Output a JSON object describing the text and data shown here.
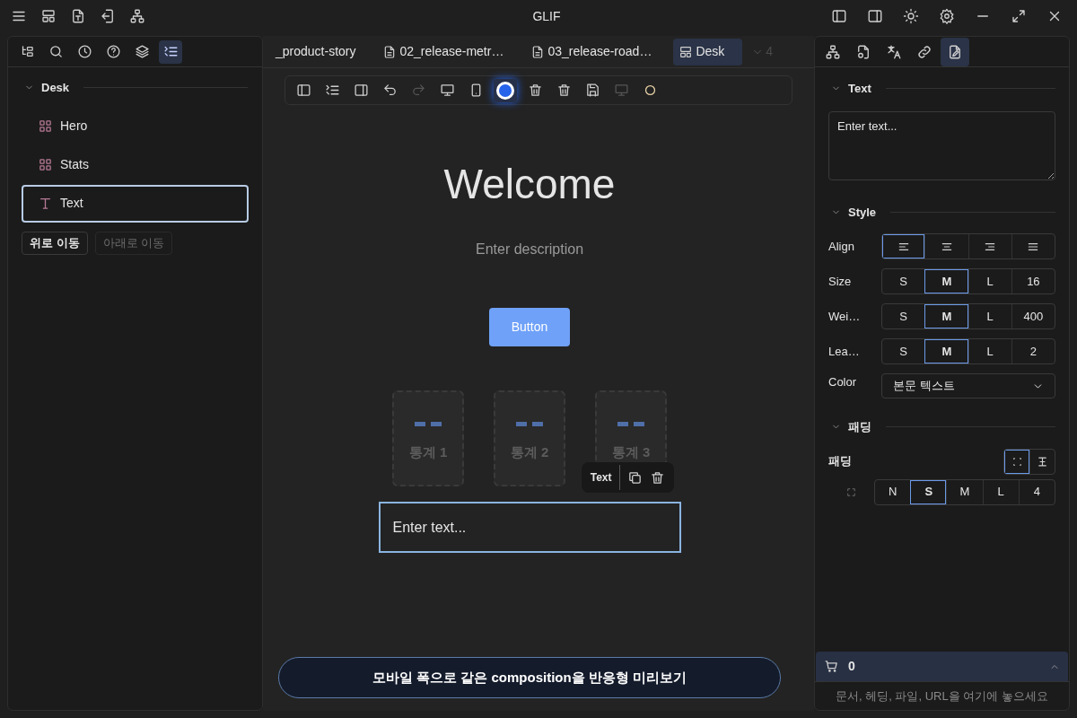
{
  "app": {
    "title": "GLIF"
  },
  "left_panel": {
    "tabs": [
      {
        "kind": "tree",
        "selected": false
      },
      {
        "kind": "search",
        "selected": false
      },
      {
        "kind": "clock",
        "selected": false
      },
      {
        "kind": "help",
        "selected": false
      },
      {
        "kind": "layers",
        "selected": false
      },
      {
        "kind": "outline",
        "selected": true
      }
    ],
    "section": {
      "title": "Desk",
      "expanded": true
    },
    "items": [
      {
        "kind": "block",
        "label": "Hero",
        "selected": false
      },
      {
        "kind": "block",
        "label": "Stats",
        "selected": false
      },
      {
        "kind": "text",
        "label": "Text",
        "selected": true
      }
    ],
    "buttons": [
      {
        "label": "위로 이동",
        "disabled": false
      },
      {
        "label": "아래로 이동",
        "disabled": true
      }
    ]
  },
  "doc_tabs": {
    "tabs": [
      {
        "kind": "plain",
        "label": "_product-story",
        "selected": false
      },
      {
        "kind": "doc",
        "label": "02_release-metr…",
        "selected": false
      },
      {
        "kind": "doc",
        "label": "03_release-road…",
        "selected": false
      },
      {
        "kind": "layout",
        "label": "Desk",
        "selected": true
      }
    ],
    "overflow": "4"
  },
  "toolbar": [
    {
      "kind": "sidebar-left",
      "disabled": false
    },
    {
      "kind": "outline",
      "disabled": false
    },
    {
      "kind": "sidebar-right",
      "disabled": false
    },
    {
      "kind": "undo",
      "disabled": false
    },
    {
      "kind": "redo",
      "disabled": true
    },
    {
      "kind": "monitor",
      "disabled": false
    },
    {
      "kind": "tablet",
      "disabled": false
    },
    {
      "kind": "color",
      "disabled": false
    },
    {
      "kind": "trash",
      "disabled": false
    },
    {
      "kind": "trash",
      "disabled": false
    },
    {
      "kind": "save",
      "disabled": false
    },
    {
      "kind": "monitor",
      "disabled": true
    },
    {
      "kind": "circle",
      "disabled": false
    }
  ],
  "canvas": {
    "heading": "Welcome",
    "description": "Enter description",
    "button": "Button",
    "stats": [
      {
        "label": "통계 1"
      },
      {
        "label": "통계 2"
      },
      {
        "label": "통계 3"
      }
    ],
    "selection_toolbar": {
      "label": "Text"
    },
    "text_block": "Enter text...",
    "preview_button": "모바일 폭으로 같은 composition을 반응형 미리보기"
  },
  "right_panel": {
    "tabs": [
      {
        "kind": "sitemap",
        "selected": false
      },
      {
        "kind": "file-search",
        "selected": false
      },
      {
        "kind": "translate",
        "selected": false
      },
      {
        "kind": "link",
        "selected": false
      },
      {
        "kind": "file-pen",
        "selected": true
      }
    ],
    "text_section": {
      "title": "Text",
      "expanded": true,
      "value": "Enter text..."
    },
    "style_section": {
      "title": "Style",
      "expanded": true,
      "rows": [
        {
          "kind": "align",
          "label": "Align",
          "options": [
            {
              "kind": "left",
              "selected": true
            },
            {
              "kind": "center",
              "selected": false
            },
            {
              "kind": "right",
              "selected": false
            },
            {
              "kind": "justify",
              "selected": false
            }
          ]
        },
        {
          "kind": "segments",
          "label": "Size",
          "options": [
            {
              "label": "S",
              "selected": false
            },
            {
              "label": "M",
              "selected": true
            },
            {
              "label": "L",
              "selected": false
            }
          ],
          "value": "16"
        },
        {
          "kind": "segments",
          "label": "Wei…",
          "options": [
            {
              "label": "S",
              "selected": false
            },
            {
              "label": "M",
              "selected": true
            },
            {
              "label": "L",
              "selected": false
            }
          ],
          "value": "400"
        },
        {
          "kind": "segments",
          "label": "Lea…",
          "options": [
            {
              "label": "S",
              "selected": false
            },
            {
              "label": "M",
              "selected": true
            },
            {
              "label": "L",
              "selected": false
            }
          ],
          "value": "2"
        },
        {
          "kind": "select",
          "label": "Color",
          "value": "본문 텍스트"
        }
      ]
    },
    "padding_section": {
      "title": "패딩",
      "expanded": true,
      "label": "패딩",
      "modes": [
        {
          "kind": "all",
          "selected": true
        },
        {
          "kind": "axis",
          "selected": false
        }
      ],
      "options": [
        {
          "label": "N",
          "selected": false
        },
        {
          "label": "S",
          "selected": true
        },
        {
          "label": "M",
          "selected": false
        },
        {
          "label": "L",
          "selected": false
        }
      ],
      "value": "4"
    },
    "footer": {
      "count": "0",
      "expanded": false,
      "hint": "문서, 헤딩, 파일, URL을 여기에 놓으세요"
    }
  }
}
